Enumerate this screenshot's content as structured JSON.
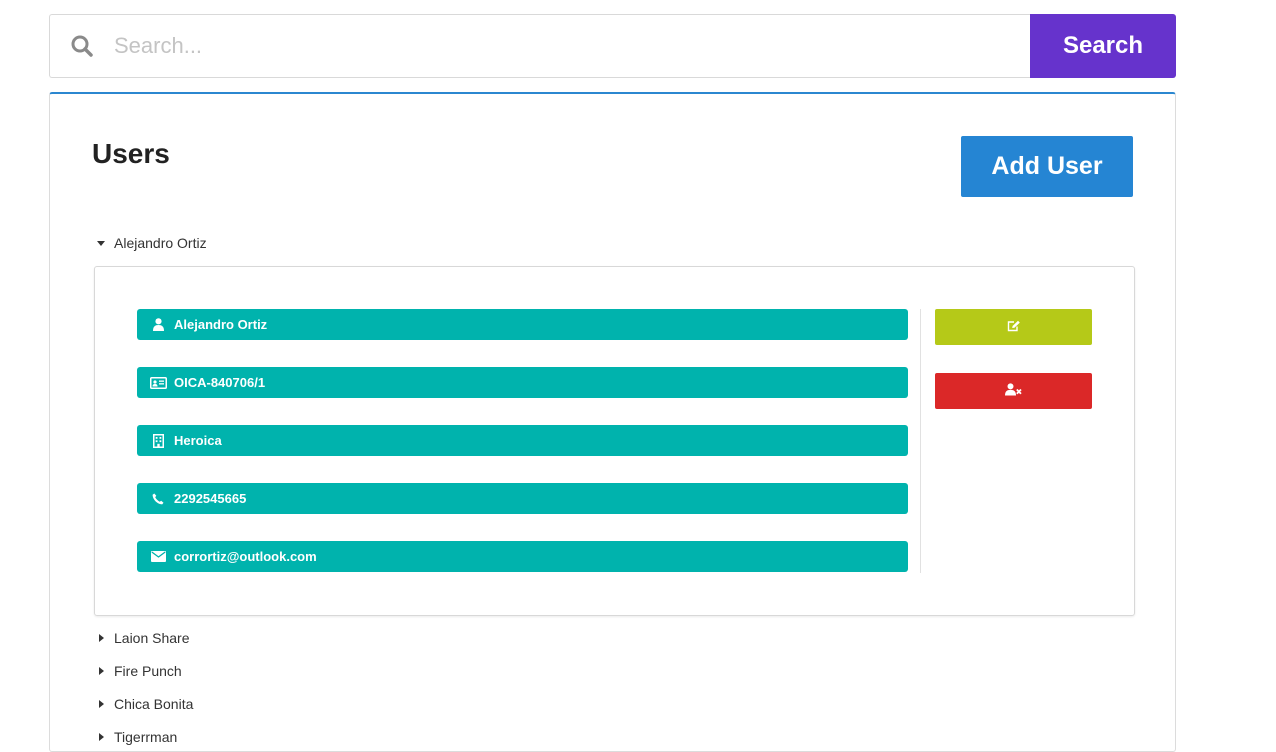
{
  "search": {
    "placeholder": "Search...",
    "value": "",
    "button_label": "Search"
  },
  "panel": {
    "title": "Users",
    "add_user_label": "Add User"
  },
  "users": [
    {
      "name": "Alejandro Ortiz",
      "expanded": true,
      "details": {
        "full_name": "Alejandro Ortiz",
        "id_code": "OICA-840706/1",
        "company": "Heroica",
        "phone": "2292545665",
        "email": "corrortiz@outlook.com"
      }
    },
    {
      "name": "Laion Share",
      "expanded": false
    },
    {
      "name": "Fire Punch",
      "expanded": false
    },
    {
      "name": "Chica Bonita",
      "expanded": false
    },
    {
      "name": "Tigerrman",
      "expanded": false
    }
  ],
  "icons": {
    "search": "search-icon",
    "user": "user-icon",
    "id_card": "id-card-icon",
    "building": "building-icon",
    "phone": "phone-icon",
    "email": "envelope-icon",
    "edit": "edit-icon",
    "remove_user": "user-remove-icon"
  },
  "colors": {
    "search_button": "#6633cc",
    "add_user_button": "#2585d3",
    "info_pill": "#00b3ad",
    "edit_button": "#b5c918",
    "delete_button": "#db2828",
    "panel_top_border": "#2b87d0"
  }
}
